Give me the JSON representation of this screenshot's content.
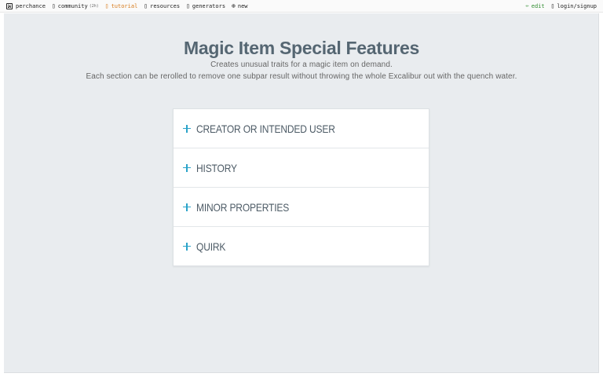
{
  "nav": {
    "brand": "perchance",
    "community_label": "community",
    "community_badge": "(2h)",
    "tutorial_label": "tutorial",
    "resources_label": "resources",
    "generators_label": "generators",
    "new_label": "new",
    "edit_label": "edit",
    "login_label": "login/signup",
    "tutorial_color": "#d77a1a",
    "edit_color": "#2e8b2e"
  },
  "main": {
    "title": "Magic Item Special Features",
    "description_line1": "Creates unusual traits for a magic item on demand.",
    "description_line2": "Each section can be rerolled to remove one subpar result without throwing the whole Excalibur out with the quench water.",
    "sections": [
      {
        "label": "CREATOR OR INTENDED USER",
        "icon": "plus-icon"
      },
      {
        "label": "HISTORY",
        "icon": "plus-icon"
      },
      {
        "label": "MINOR PROPERTIES",
        "icon": "plus-icon"
      },
      {
        "label": "QUIRK",
        "icon": "plus-icon"
      }
    ],
    "accent_color": "#2aa3c9",
    "panel_background": "#e9ecef"
  }
}
